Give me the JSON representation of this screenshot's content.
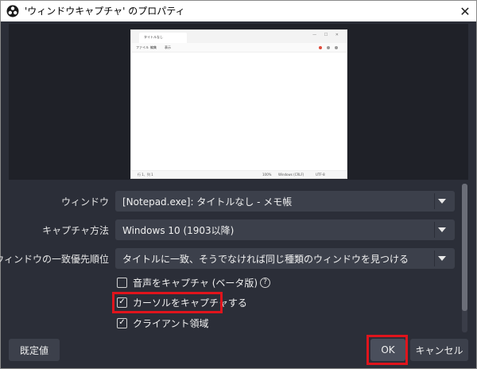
{
  "window": {
    "title": "'ウィンドウキャプチャ' のプロパティ",
    "close_glyph": "✕"
  },
  "preview": {
    "notepad": {
      "tab_title": "タイトルなし",
      "menu": [
        "ファイル",
        "編集",
        "表示"
      ],
      "status": [
        "行 1、列 1",
        "100%",
        "Windows (CRLF)",
        "UTF-8"
      ],
      "window_buttons": "— ☐ ✕"
    }
  },
  "form": {
    "window": {
      "label": "ウィンドウ",
      "value": "[Notepad.exe]: タイトルなし - メモ帳"
    },
    "capture_method": {
      "label": "キャプチャ方法",
      "value": "Windows 10 (1903以降)"
    },
    "window_match_priority": {
      "label": "ウィンドウの一致優先順位",
      "value": "タイトルに一致、そうでなければ同じ種類のウィンドウを見つける"
    },
    "checkboxes": [
      {
        "label": "音声をキャプチャ (ベータ版)",
        "checked": false,
        "has_help": true
      },
      {
        "label": "カーソルをキャプチャする",
        "checked": true,
        "has_help": false
      },
      {
        "label": "クライアント領域",
        "checked": true,
        "has_help": false
      }
    ]
  },
  "buttons": {
    "defaults": "既定値",
    "ok": "OK",
    "cancel": "キャンセル"
  },
  "colors": {
    "background": "#2b2e38",
    "control": "#3c404b",
    "highlight": "#e0141c"
  }
}
